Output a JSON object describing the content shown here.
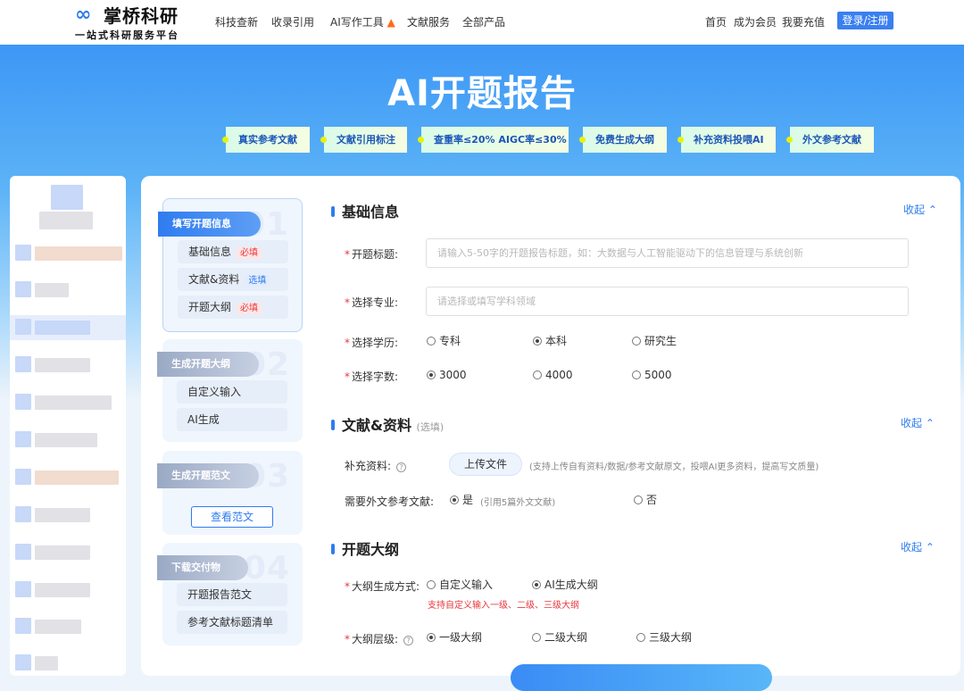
{
  "brand": {
    "logo_mark": "∞",
    "name": "掌桥科研",
    "slogan": "一站式科研服务平台"
  },
  "nav": {
    "left": [
      "科技查新",
      "收录引用",
      "AI写作工具",
      "文献服务",
      "全部产品"
    ],
    "right": [
      "首页",
      "成为会员",
      "我要充值"
    ],
    "login": "登录/注册"
  },
  "hero": {
    "title": "AI开题报告",
    "tags": [
      "真实参考文献",
      "文献引用标注",
      "查重率≤20%  AIGC率≤30%",
      "免费生成大纲",
      "补充资料投喂AI",
      "外文参考文献"
    ]
  },
  "steps": [
    {
      "title": "填写开题信息",
      "num": "01",
      "items": [
        {
          "label": "基础信息",
          "badge": "必填"
        },
        {
          "label": "文献&资料",
          "badge": "选填"
        },
        {
          "label": "开题大纲",
          "badge": "必填"
        }
      ]
    },
    {
      "title": "生成开题大纲",
      "num": "02",
      "items": [
        {
          "label": "自定义输入"
        },
        {
          "label": "AI生成"
        }
      ]
    },
    {
      "title": "生成开题范文",
      "num": "03",
      "button": "查看范文"
    },
    {
      "title": "下载交付物",
      "num": "04",
      "items": [
        {
          "label": "开题报告范文"
        },
        {
          "label": "参考文献标题清单"
        }
      ]
    }
  ],
  "sections": {
    "basic": {
      "title": "基础信息",
      "collapse": "收起",
      "topic_label": "开题标题:",
      "topic_placeholder": "请输入5-50字的开题报告标题，如：大数据与人工智能驱动下的信息管理与系统创新",
      "major_label": "选择专业:",
      "major_placeholder": "请选择或填写学科领域",
      "degree_label": "选择学历:",
      "degree_options": [
        "专科",
        "本科",
        "研究生"
      ],
      "degree_selected": "本科",
      "words_label": "选择字数:",
      "words_options": [
        "3000",
        "4000",
        "5000"
      ],
      "words_selected": "3000"
    },
    "docs": {
      "title": "文献&资料",
      "subtitle": "(选填)",
      "collapse": "收起",
      "supplement_label": "补充资料:",
      "upload_button": "上传文件",
      "upload_hint": "(支持上传自有资料/数据/参考文献原文，投喂AI更多资料，提高写文质量)",
      "foreign_label": "需要外文参考文献:",
      "foreign_yes": "是",
      "foreign_yes_hint": "(引用5篇外文文献)",
      "foreign_no": "否"
    },
    "outline": {
      "title": "开题大纲",
      "collapse": "收起",
      "method_label": "大纲生成方式:",
      "method_options": [
        "自定义输入",
        "AI生成大纲"
      ],
      "method_selected": "AI生成大纲",
      "method_hint": "支持自定义输入一级、二级、三级大纲",
      "level_label": "大纲层级:",
      "level_options": [
        "一级大纲",
        "二级大纲",
        "三级大纲"
      ],
      "level_selected": "一级大纲"
    }
  }
}
